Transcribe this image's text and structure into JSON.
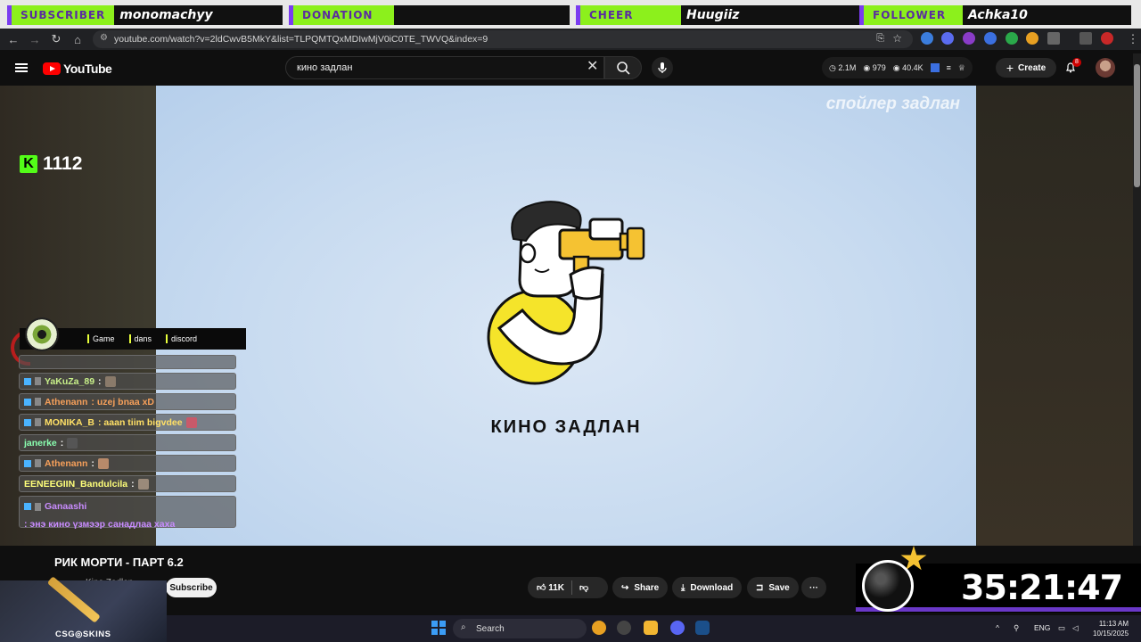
{
  "alerts": [
    {
      "tag": "SUBSCRIBER",
      "name": "monomachyy"
    },
    {
      "tag": "DONATION",
      "name": ""
    },
    {
      "tag": "CHEER",
      "name": "Huugiiz"
    },
    {
      "tag": "FOLLOWER",
      "name": "Achka10"
    }
  ],
  "browser": {
    "url": "youtube.com/watch?v=2ldCwvB5MkY&list=TLPQMTQxMDIwMjV0iC0TE_TWVQ&index=9"
  },
  "youtube": {
    "logo_text": "YouTube",
    "search_value": "кино задлан",
    "stats": {
      "subscribers": "2.1M",
      "views": "979",
      "watch": "40.4K"
    },
    "create_label": "Create",
    "notifications": "8"
  },
  "video": {
    "watermark": "спойлер задлан",
    "channel_title": "КИНО ЗАДЛАН"
  },
  "kick": {
    "icon": "K",
    "count": "1112"
  },
  "chat": {
    "links": [
      "Game",
      "dans",
      "discord"
    ],
    "messages": [
      {
        "user": "",
        "text": "",
        "color": "#ffffff"
      },
      {
        "user": "YaKuZa_89",
        "text": " :",
        "color": "#c8f08a"
      },
      {
        "user": "Athenann",
        "text": " : uzej bnaa xD",
        "color": "#f7a05a"
      },
      {
        "user": "MONIKA_B",
        "text": " : aaan tiim bigvdee",
        "color": "#ffe066"
      },
      {
        "user": "janerke",
        "text": " :",
        "color": "#8affb0"
      },
      {
        "user": "Athenann",
        "text": " :",
        "color": "#f7a05a"
      },
      {
        "user": "EENEEGIIN_Bandulcila",
        "text": " :",
        "color": "#ffff7a"
      },
      {
        "user": "Ganaashi",
        "text": " : энэ кино үзмээр санадлаа хаха",
        "color": "#c98cff"
      }
    ]
  },
  "below": {
    "title": "РИК МОРТИ - ПАРТ 6.2",
    "channel": "Kino Zadlan",
    "subscribe_label": "Subscribe",
    "likes": "11K",
    "share_label": "Share",
    "download_label": "Download",
    "save_label": "Save",
    "more": "···"
  },
  "csgo": {
    "label": "CSG◎SKINS"
  },
  "timer": {
    "value": "35:21:47"
  },
  "taskbar": {
    "search_label": "Search",
    "lang": "ENG",
    "time": "11:13 AM",
    "date": "10/15/2025"
  },
  "colors": {
    "accent_green": "#8cf01c",
    "accent_purple": "#7a3cf0",
    "yt_red": "#ff0000"
  }
}
